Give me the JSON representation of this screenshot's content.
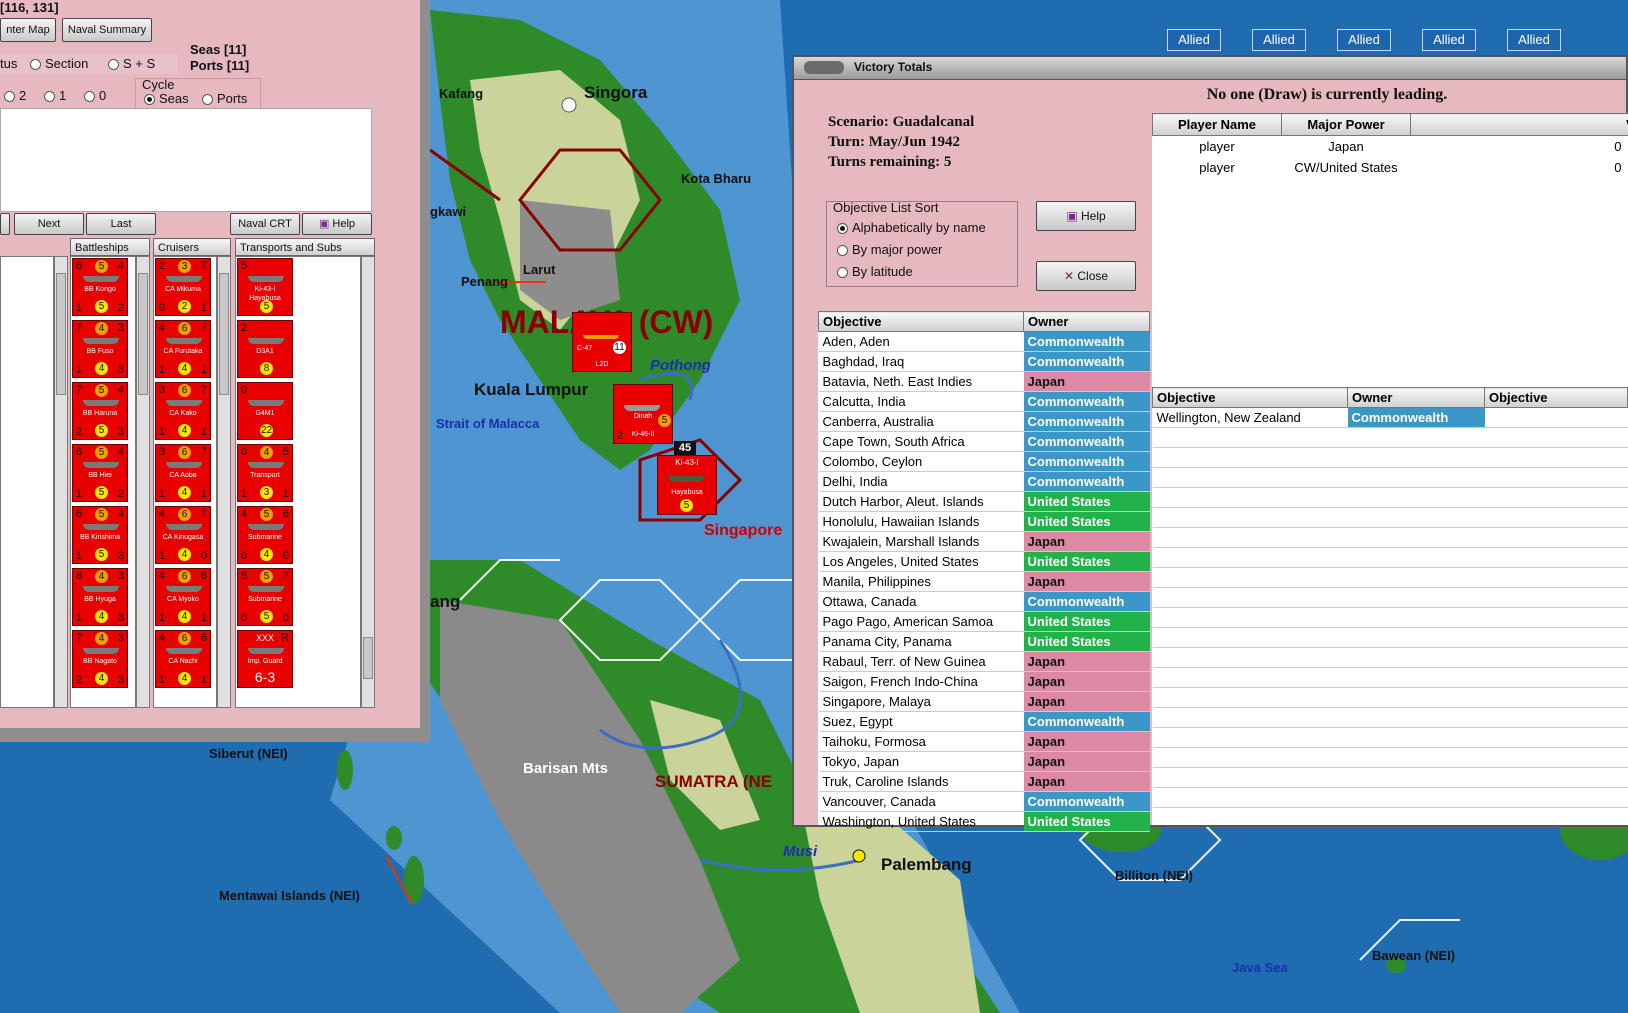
{
  "naval_panel": {
    "coords": "[116, 131]",
    "buttons": {
      "center_map": "nter Map",
      "naval_summary": "Naval Summary",
      "next": "Next",
      "last": "Last",
      "naval_crt": "Naval CRT",
      "help": "Help"
    },
    "seas": "Seas [11]",
    "ports": "Ports [11]",
    "filter_options": [
      "tus",
      "Section",
      "S + S"
    ],
    "filter_selected": -1,
    "number_options": [
      "2",
      "1",
      "0"
    ],
    "cycle": {
      "label": "Cycle",
      "options": [
        "Seas",
        "Ports"
      ],
      "selected": "Seas"
    },
    "columns": [
      "Battleships",
      "Cruisers",
      "Transports and Subs"
    ],
    "battleships": [
      {
        "name": "BB Kongo",
        "tl": "6",
        "mid": "5",
        "tr": "4",
        "bl": "1",
        "midb": "5",
        "br": "2"
      },
      {
        "name": "BB Fuso",
        "tl": "7",
        "mid": "4",
        "tr": "3",
        "bl": "1",
        "midb": "4",
        "br": "3"
      },
      {
        "name": "BB Haruna",
        "tl": "7",
        "mid": "5",
        "tr": "4",
        "bl": "2",
        "midb": "5",
        "br": "3"
      },
      {
        "name": "BB Hiei",
        "tl": "6",
        "mid": "5",
        "tr": "4",
        "bl": "1",
        "midb": "5",
        "br": "2"
      },
      {
        "name": "BB Kirishima",
        "tl": "6",
        "mid": "5",
        "tr": "4",
        "bl": "1",
        "midb": "5",
        "br": "3"
      },
      {
        "name": "BB Hyuga",
        "tl": "8",
        "mid": "4",
        "tr": "3",
        "bl": "1",
        "midb": "4",
        "br": "3"
      },
      {
        "name": "BB Nagato",
        "tl": "7",
        "mid": "4",
        "tr": "3",
        "bl": "2",
        "midb": "4",
        "br": "3"
      }
    ],
    "cruisers": [
      {
        "name": "CA Mikuma",
        "tl": "2",
        "mid": "3",
        "tr": "7",
        "bl": "0",
        "midb": "2",
        "br": "1"
      },
      {
        "name": "CA Furutaka",
        "tl": "4",
        "mid": "6",
        "tr": "7",
        "bl": "1",
        "midb": "4",
        "br": "1"
      },
      {
        "name": "CA Kako",
        "tl": "3",
        "mid": "6",
        "tr": "7",
        "bl": "1",
        "midb": "4",
        "br": "1"
      },
      {
        "name": "CA Aoba",
        "tl": "3",
        "mid": "6",
        "tr": "7",
        "bl": "1",
        "midb": "4",
        "br": "1"
      },
      {
        "name": "CA Kinugasa",
        "tl": "4",
        "mid": "6",
        "tr": "7",
        "bl": "1",
        "midb": "4",
        "br": "0"
      },
      {
        "name": "CA Myoko",
        "tl": "4",
        "mid": "6",
        "tr": "6",
        "bl": "1",
        "midb": "4",
        "br": "1"
      },
      {
        "name": "CA Nachi",
        "tl": "4",
        "mid": "6",
        "tr": "6",
        "bl": "1",
        "midb": "4",
        "br": "1"
      }
    ],
    "transports": [
      {
        "name": "Ki-43-I",
        "sub": "Hayabusa",
        "tl": "5",
        "midb": "5"
      },
      {
        "name": "D3A1",
        "tl": "2",
        "midb": "8"
      },
      {
        "name": "G4M1",
        "tl": "0",
        "midb": "22"
      },
      {
        "name": "Transport",
        "tl": "0",
        "mid": "4",
        "tr": "5",
        "bl": "1",
        "midb": "3",
        "br": "1"
      },
      {
        "name": "Submarine",
        "tl": "4",
        "mid": "5",
        "tr": "6",
        "bl": "0",
        "midb": "4",
        "br": "0"
      },
      {
        "name": "Submarine",
        "tl": "5",
        "mid": "5",
        "tr": "7",
        "bl": "0",
        "midb": "5",
        "br": "0"
      },
      {
        "name": "Imp. Guard",
        "top": "XXX",
        "corner": "R",
        "value": "6-3"
      }
    ]
  },
  "victory": {
    "title": "Victory Totals",
    "leading": "No one (Draw) is currently leading.",
    "scenario": "Scenario: Guadalcanal",
    "turn": "Turn: May/Jun 1942",
    "remaining": "Turns remaining: 5",
    "sort": {
      "legend": "Objective List Sort",
      "options": [
        "Alphabetically by name",
        "By major power",
        "By latitude"
      ],
      "selected": 0
    },
    "help": "Help",
    "close": "Close",
    "players_header": [
      "Player Name",
      "Major Power",
      "Victory Po"
    ],
    "players": [
      [
        "player",
        "Japan",
        "0"
      ],
      [
        "player",
        "CW/United States",
        "0"
      ]
    ],
    "objectives_header": [
      "Objective",
      "Owner"
    ],
    "objectives": [
      [
        "Aden, Aden",
        "Commonwealth"
      ],
      [
        "Baghdad, Iraq",
        "Commonwealth"
      ],
      [
        "Batavia, Neth. East Indies",
        "Japan"
      ],
      [
        "Calcutta, India",
        "Commonwealth"
      ],
      [
        "Canberra, Australia",
        "Commonwealth"
      ],
      [
        "Cape Town, South Africa",
        "Commonwealth"
      ],
      [
        "Colombo, Ceylon",
        "Commonwealth"
      ],
      [
        "Delhi, India",
        "Commonwealth"
      ],
      [
        "Dutch Harbor, Aleut. Islands",
        "United States"
      ],
      [
        "Honolulu, Hawaiian Islands",
        "United States"
      ],
      [
        "Kwajalein, Marshall Islands",
        "Japan"
      ],
      [
        "Los Angeles, United States",
        "United States"
      ],
      [
        "Manila, Philippines",
        "Japan"
      ],
      [
        "Ottawa, Canada",
        "Commonwealth"
      ],
      [
        "Pago Pago, American Samoa",
        "United States"
      ],
      [
        "Panama City, Panama",
        "United States"
      ],
      [
        "Rabaul, Terr. of New Guinea",
        "Japan"
      ],
      [
        "Saigon, French Indo-China",
        "Japan"
      ],
      [
        "Singapore, Malaya",
        "Japan"
      ],
      [
        "Suez, Egypt",
        "Commonwealth"
      ],
      [
        "Taihoku, Formosa",
        "Japan"
      ],
      [
        "Tokyo, Japan",
        "Japan"
      ],
      [
        "Truk, Caroline Islands",
        "Japan"
      ],
      [
        "Vancouver, Canada",
        "Commonwealth"
      ],
      [
        "Washington, United States",
        "United States"
      ]
    ],
    "second_header": [
      "Objective",
      "Owner",
      "Objective"
    ],
    "second_rows": [
      [
        "Wellington, New Zealand",
        "Commonwealth"
      ]
    ]
  },
  "allied_tabs": [
    "Allied",
    "Allied",
    "Allied",
    "Allied",
    "Allied"
  ],
  "map_labels": {
    "kafang": "Kafang",
    "singora": "Singora",
    "kota_bharu": "Kota Bharu",
    "gkawi": "gkawi",
    "penang": "Penang",
    "larut": "Larut",
    "malaya": "MALAYA (CW)",
    "pothong": "Pothong",
    "kuala_lumpur": "Kuala Lumpur",
    "strait": "Strait of Malacca",
    "singapore": "Singapore",
    "ang": "ang",
    "siberut": "Siberut (NEI)",
    "barisan": "Barisan Mts",
    "sumatra": "SUMATRA (NE",
    "mentawai": "Mentawai Islands (NEI)",
    "musi": "Musi",
    "palembang": "Palembang",
    "billiton": "Billiton (NEI)",
    "java_sea": "Java Sea",
    "bawean": "Bawean (NEI)"
  },
  "map_units": [
    {
      "name": "C-47",
      "sub": "L2D",
      "top": "11"
    },
    {
      "name": "Dinah",
      "sub": "Ki-46-II",
      "corner": "5",
      "bl": "2"
    },
    {
      "name": "Ki-43-I",
      "sub": "Hayabusa",
      "top": "45",
      "midb": "5"
    }
  ]
}
